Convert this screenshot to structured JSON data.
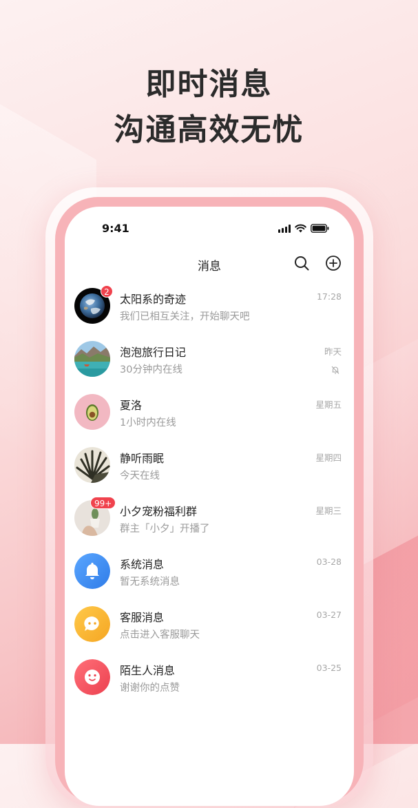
{
  "headline": {
    "line1": "即时消息",
    "line2": "沟通高效无忧"
  },
  "status_bar": {
    "time": "9:41",
    "icons": [
      "signal-icon",
      "wifi-icon",
      "battery-icon"
    ]
  },
  "nav": {
    "title": "消息",
    "icons": [
      "search-icon",
      "add-circle-icon"
    ]
  },
  "conversations": [
    {
      "name": "太阳系的奇迹",
      "preview": "我们已相互关注，开始聊天吧",
      "time": "17:28",
      "badge": "2",
      "avatar": "earth-photo"
    },
    {
      "name": "泡泡旅行日记",
      "preview": "30分钟内在线",
      "time": "昨天",
      "muted": true,
      "avatar": "lake-photo"
    },
    {
      "name": "夏洛",
      "preview": "1小时内在线",
      "time": "星期五",
      "avatar": "avocado-photo"
    },
    {
      "name": "静听雨眠",
      "preview": "今天在线",
      "time": "星期四",
      "avatar": "palm-leaf-photo"
    },
    {
      "name": "小夕宠粉福利群",
      "preview": "群主「小夕」开播了",
      "time": "星期三",
      "badge": "99+",
      "avatar": "cactus-photo"
    },
    {
      "name": "系统消息",
      "preview": "暂无系统消息",
      "time": "03-28",
      "avatar": "bell-icon",
      "color": "#3d8ef6"
    },
    {
      "name": "客服消息",
      "preview": "点击进入客服聊天",
      "time": "03-27",
      "avatar": "chat-bubble-icon",
      "color": "#f9b233"
    },
    {
      "name": "陌生人消息",
      "preview": "谢谢你的点赞",
      "time": "03-25",
      "avatar": "smile-face-icon",
      "color": "#f2545e"
    }
  ],
  "colors": {
    "badge": "#f0424d",
    "frame": "#f7b3b8"
  }
}
